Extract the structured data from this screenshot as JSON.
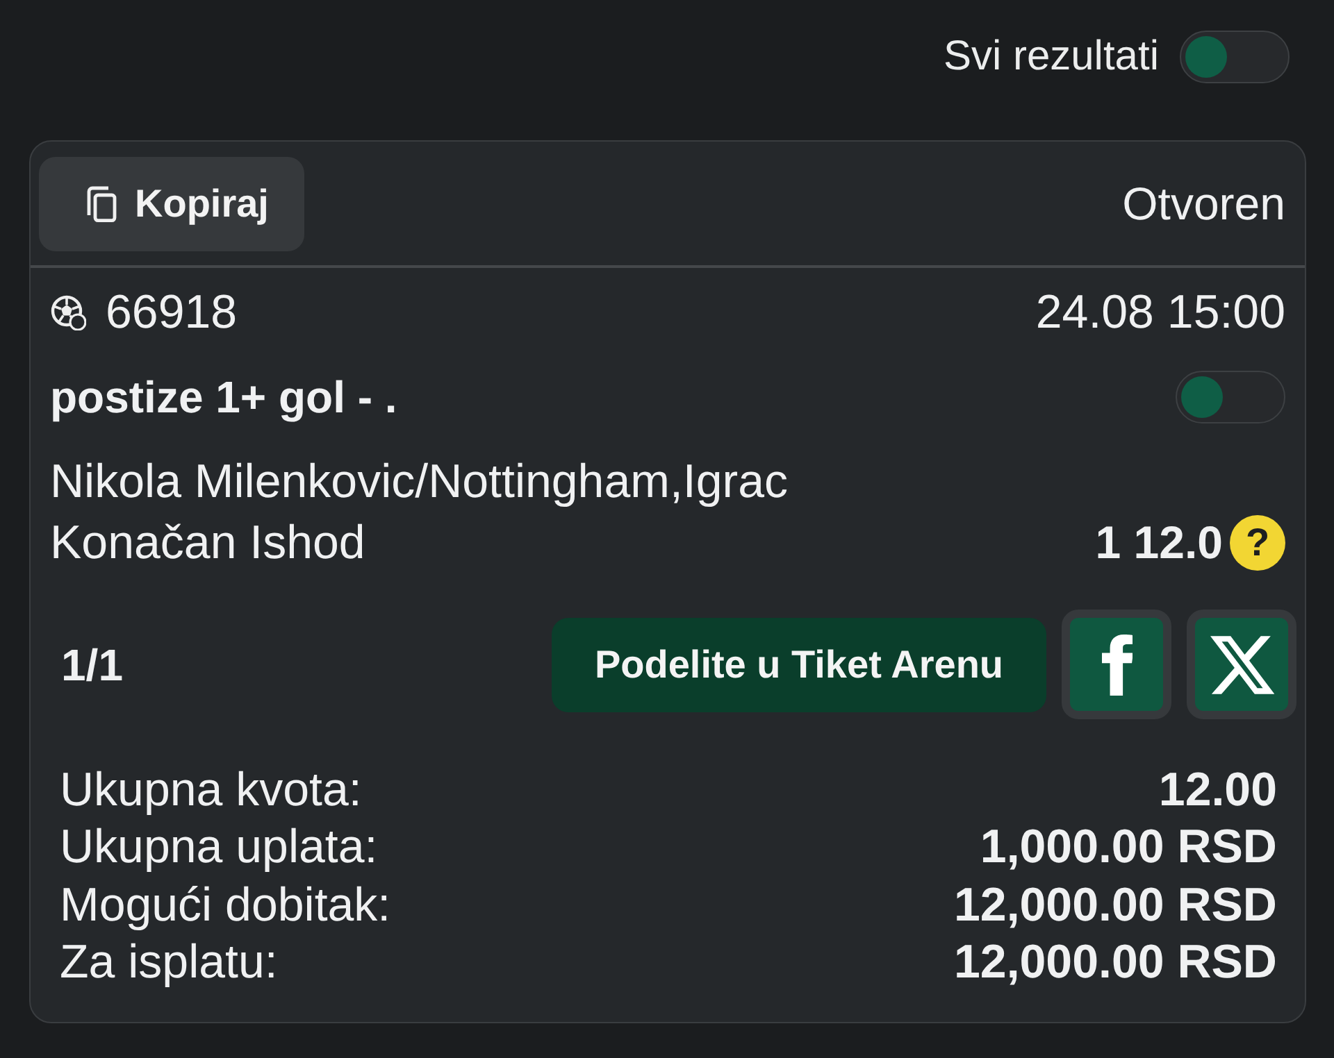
{
  "results_filter": {
    "label": "Svi rezultati",
    "on": false
  },
  "ticket": {
    "copy_button": "Kopiraj",
    "status": "Otvoren",
    "selection": {
      "event_code": "66918",
      "datetime": "24.08 15:00",
      "market": "postize 1+ gol - .",
      "market_toggle_on": false,
      "player": "Nikola Milenkovic/Nottingham,Igrac",
      "outcome": "Konačan Ishod",
      "odds": "1 12.0",
      "help_mark": "?"
    },
    "count": "1/1",
    "share_button": "Podelite u Tiket Arenu",
    "social_buttons": [
      {
        "kind": "facebook"
      },
      {
        "kind": "x"
      }
    ],
    "summary": [
      {
        "label": "Ukupna kvota:",
        "value": "12.00"
      },
      {
        "label": "Ukupna uplata:",
        "value": "1,000.00 RSD"
      },
      {
        "label": "Mogući dobitak:",
        "value": "12,000.00 RSD"
      },
      {
        "label": "Za isplatu:",
        "value": "12,000.00 RSD"
      }
    ]
  }
}
